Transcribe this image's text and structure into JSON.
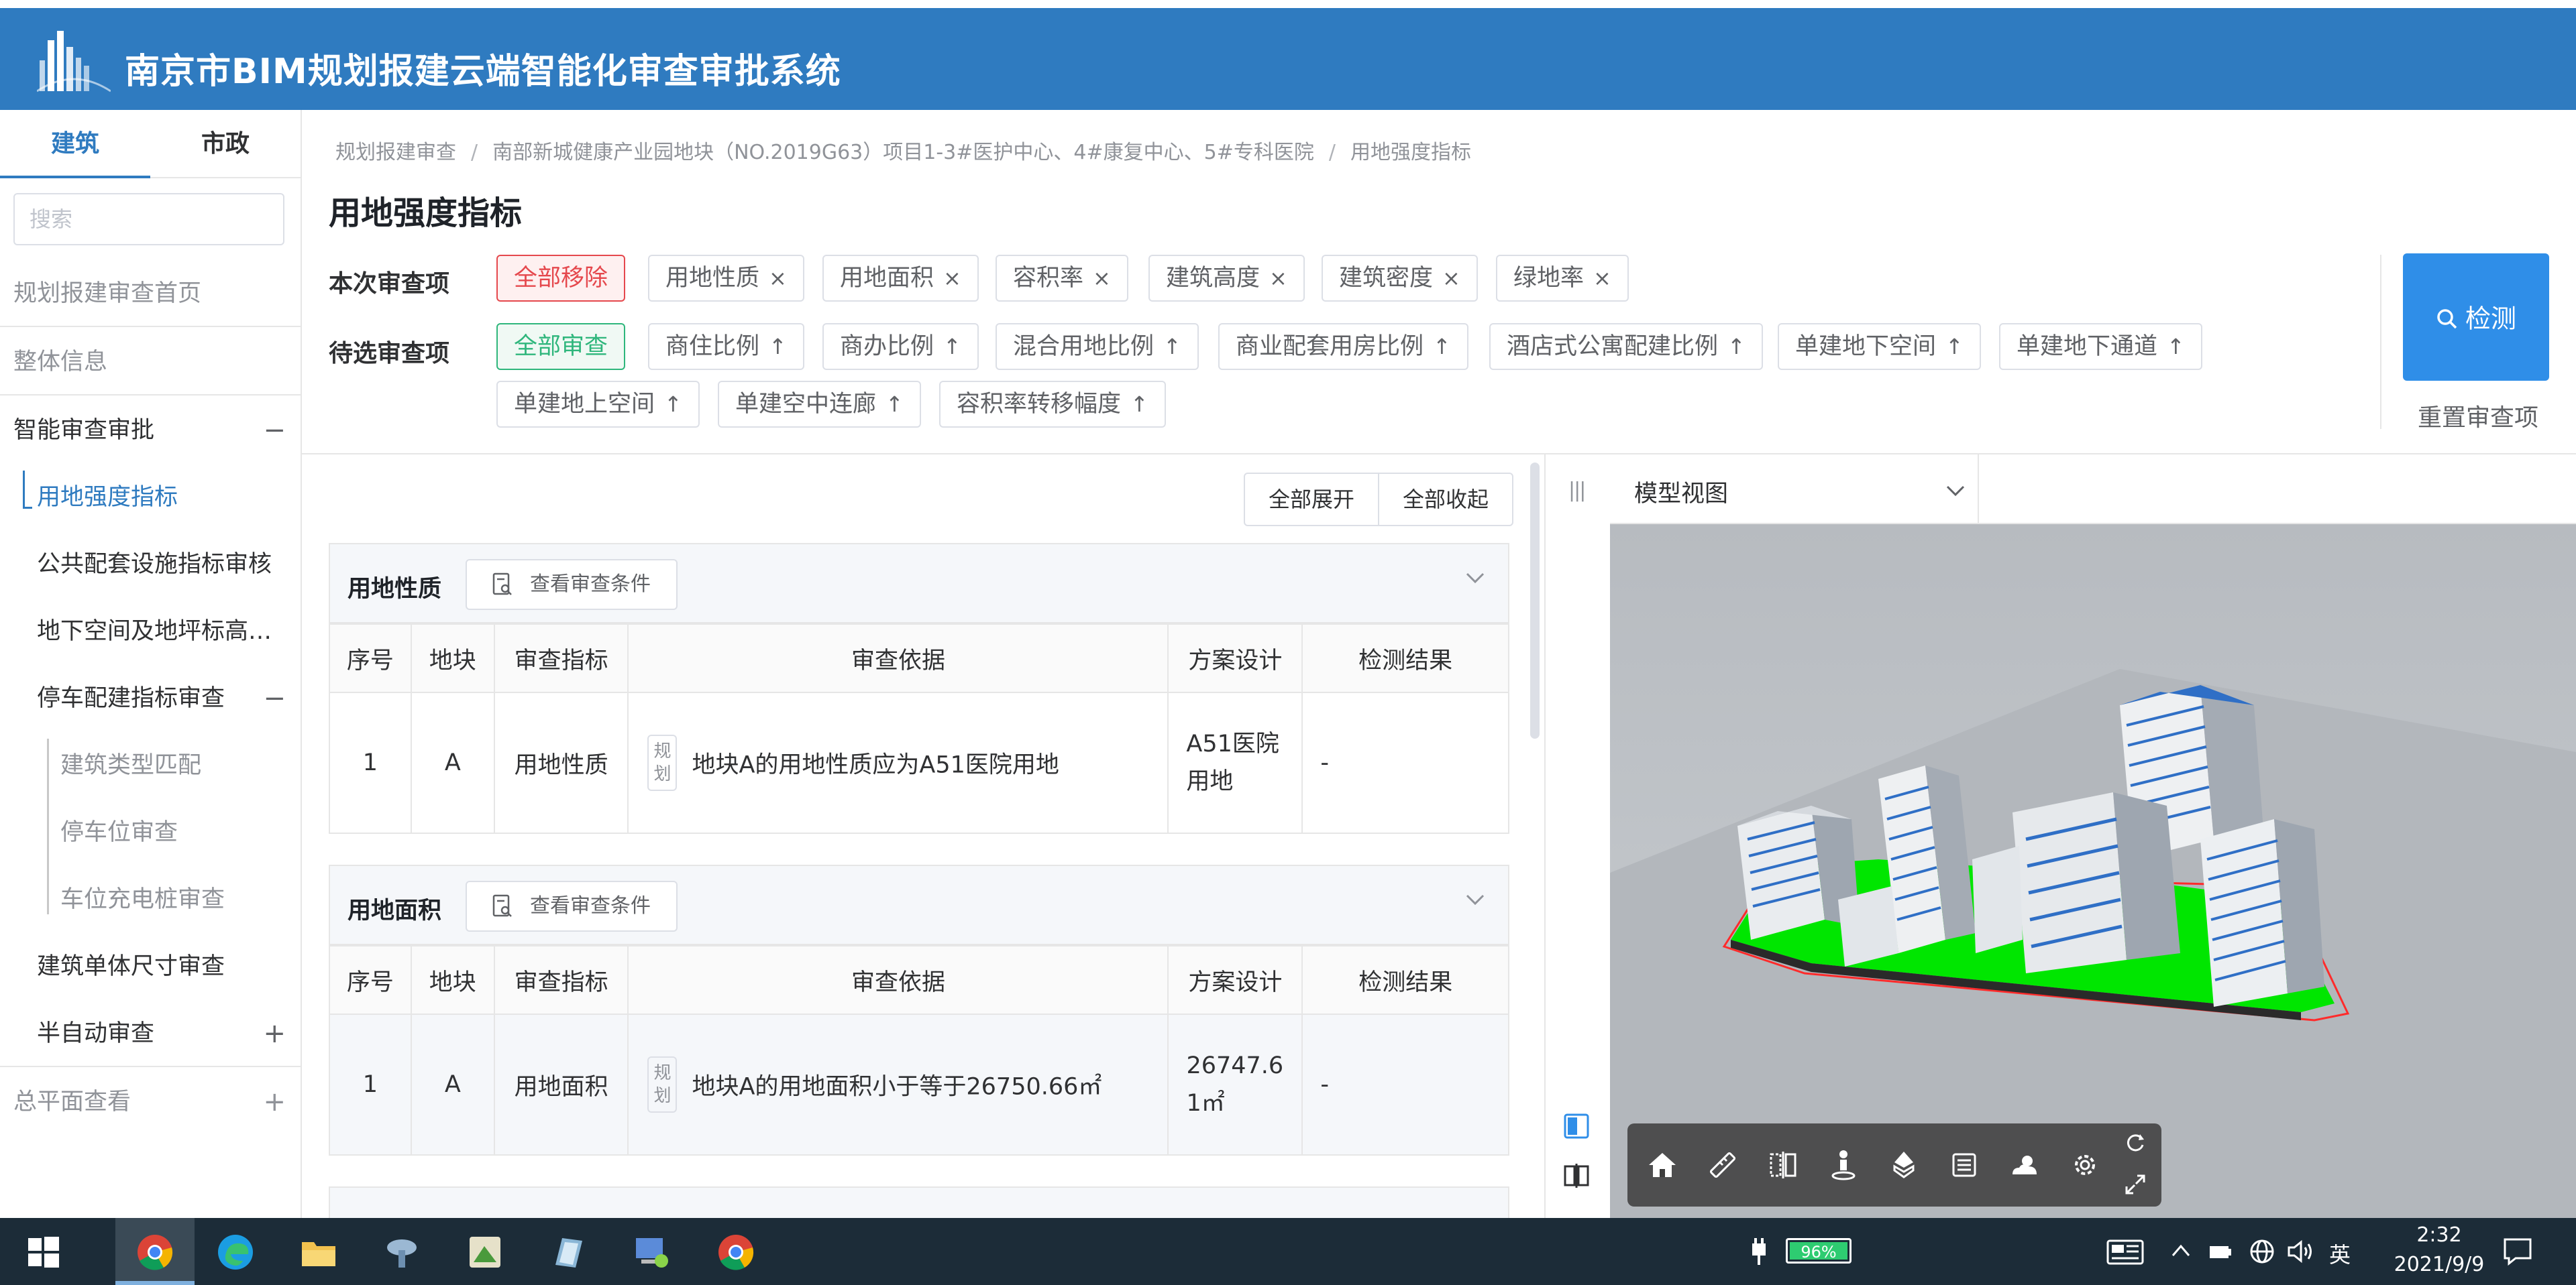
{
  "header": {
    "title": "南京市BIM规划报建云端智能化审查审批系统"
  },
  "sidebar": {
    "tabs": [
      "建筑",
      "市政"
    ],
    "search_placeholder": "搜索",
    "items": [
      {
        "label": "规划报建审查首页"
      },
      {
        "label": "整体信息"
      },
      {
        "label": "智能审查审批",
        "sign": "−"
      },
      {
        "label": "用地强度指标"
      },
      {
        "label": "公共配套设施指标审核"
      },
      {
        "label": "地下空间及地坪标高…"
      },
      {
        "label": "停车配建指标审查",
        "sign": "−"
      },
      {
        "label": "建筑类型匹配"
      },
      {
        "label": "停车位审查"
      },
      {
        "label": "车位充电桩审查"
      },
      {
        "label": "建筑单体尺寸审查"
      },
      {
        "label": "半自动审查",
        "sign": "+"
      },
      {
        "label": "总平面查看",
        "sign": "+"
      }
    ]
  },
  "breadcrumb": [
    "规划报建审查",
    "南部新城健康产业园地块（NO.2019G63）项目1-3#医护中心、4#康复中心、5#专科医院",
    "用地强度指标"
  ],
  "page_title": "用地强度指标",
  "current_items": {
    "label": "本次审查项",
    "remove_all": "全部移除",
    "chips": [
      "用地性质",
      "用地面积",
      "容积率",
      "建筑高度",
      "建筑密度",
      "绿地率"
    ],
    "remove_symbol": "×"
  },
  "pending_items": {
    "label": "待选审查项",
    "review_all": "全部审查",
    "chips": [
      "商住比例",
      "商办比例",
      "混合用地比例",
      "商业配套用房比例",
      "酒店式公寓配建比例",
      "单建地下空间",
      "单建地下通道",
      "单建地上空间",
      "单建空中连廊",
      "容积率转移幅度"
    ],
    "add_symbol": "↑"
  },
  "actions": {
    "detect": "检测",
    "reset": "重置审查项",
    "expand_all": "全部展开",
    "collapse_all": "全部收起"
  },
  "table_headers": [
    "序号",
    "地块",
    "审查指标",
    "审查依据",
    "方案设计",
    "检测结果"
  ],
  "sections": [
    {
      "name": "用地性质",
      "view_conditions": "查看审查条件",
      "row": {
        "index": "1",
        "plot": "A",
        "indicator": "用地性质",
        "tag": "规划",
        "basis": "地块A的用地性质应为A51医院用地",
        "design": "A51医院用地",
        "result": "-"
      }
    },
    {
      "name": "用地面积",
      "view_conditions": "查看审查条件",
      "row": {
        "index": "1",
        "plot": "A",
        "indicator": "用地面积",
        "tag": "规划",
        "basis": "地块A的用地面积小于等于26750.66㎡",
        "design": "26747.61㎡",
        "result": "-"
      }
    }
  ],
  "model_panel": {
    "view_select": "模型视图"
  },
  "taskbar": {
    "battery": "96%",
    "ime": "英",
    "time": "2:32",
    "date": "2021/9/9"
  },
  "colors": {
    "header_blue": "#2f7bc0",
    "primary": "#2f8ee8",
    "danger": "#e5484d",
    "success": "#2fb67c",
    "green_area": "#00e600"
  }
}
